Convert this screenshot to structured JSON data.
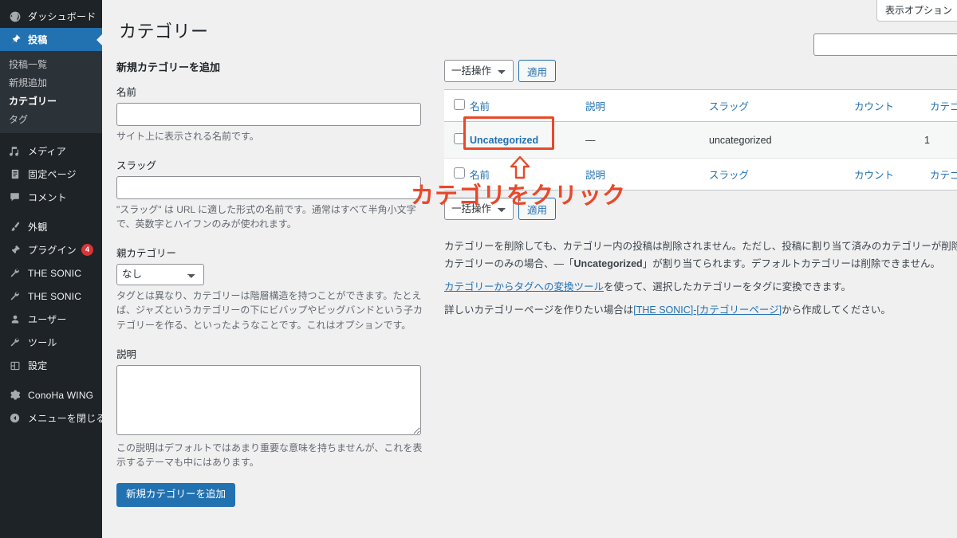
{
  "sidebar": {
    "items": [
      {
        "label": "ダッシュボード",
        "icon": "dashboard-icon",
        "current": false
      },
      {
        "label": "投稿",
        "icon": "pin-icon",
        "current": true
      },
      {
        "label": "メディア",
        "icon": "media-icon",
        "current": false
      },
      {
        "label": "固定ページ",
        "icon": "page-icon",
        "current": false
      },
      {
        "label": "コメント",
        "icon": "comment-icon",
        "current": false
      },
      {
        "label": "外観",
        "icon": "appearance-brush-icon",
        "current": false
      },
      {
        "label": "プラグイン",
        "icon": "plugin-icon",
        "current": false,
        "badge": "4"
      },
      {
        "label": "THE SONIC",
        "icon": "wrench-icon",
        "current": false
      },
      {
        "label": "THE SONIC",
        "icon": "wrench-icon",
        "current": false
      },
      {
        "label": "ユーザー",
        "icon": "user-icon",
        "current": false
      },
      {
        "label": "ツール",
        "icon": "wrench-icon",
        "current": false
      },
      {
        "label": "設定",
        "icon": "settings-icon",
        "current": false
      },
      {
        "label": "ConoHa WING",
        "icon": "gear-icon",
        "current": false
      },
      {
        "label": "メニューを閉じる",
        "icon": "collapse-icon",
        "current": false
      }
    ],
    "submenu": [
      {
        "label": "投稿一覧",
        "current": false
      },
      {
        "label": "新規追加",
        "current": false
      },
      {
        "label": "カテゴリー",
        "current": true
      },
      {
        "label": "タグ",
        "current": false
      }
    ]
  },
  "header": {
    "title": "カテゴリー",
    "screen_options": "表示オプション",
    "search_placeholder": "",
    "search_value": ""
  },
  "form": {
    "heading": "新規カテゴリーを追加",
    "name_label": "名前",
    "name_value": "",
    "name_desc": "サイト上に表示される名前です。",
    "slug_label": "スラッグ",
    "slug_value": "",
    "slug_desc": "\"スラッグ\" は URL に適した形式の名前です。通常はすべて半角小文字で、英数字とハイフンのみが使われます。",
    "parent_label": "親カテゴリー",
    "parent_selected": "なし",
    "parent_options": [
      "なし"
    ],
    "parent_desc": "タグとは異なり、カテゴリーは階層構造を持つことができます。たとえば、ジャズというカテゴリーの下にビバップやビッグバンドという子カテゴリーを作る、といったようなことです。これはオプションです。",
    "description_label": "説明",
    "description_value": "",
    "description_desc": "この説明はデフォルトではあまり重要な意味を持ちませんが、これを表示するテーマも中にはあります。",
    "submit_label": "新規カテゴリーを追加"
  },
  "tablenav": {
    "bulk_selected": "一括操作",
    "bulk_options": [
      "一括操作"
    ],
    "apply_label": "適用"
  },
  "table": {
    "columns": [
      "名前",
      "説明",
      "スラッグ",
      "カウント",
      "カテゴリペー"
    ],
    "rows": [
      {
        "name": "Uncategorized",
        "description": "—",
        "slug": "uncategorized",
        "count": "1",
        "category_page": ""
      }
    ]
  },
  "notes": {
    "line1_a": "カテゴリーを削除しても、カテゴリー内の投稿は削除されません。ただし、投稿に割り当て済みのカテゴリーが削除するカテゴリーのみの場合、",
    "line1_b": "—「",
    "line1_strong": "Uncategorized",
    "line1_c": "」が割り当てられます。デフォルトカテゴリーは削除できません。",
    "line2_link": "カテゴリーからタグへの変換ツール",
    "line2_rest": "を使って、選択したカテゴリーをタグに変換できます。",
    "line3_pre": "詳しいカテゴリーページを作りたい場合は",
    "line3_link": "[THE SONIC]-[カテゴリーページ]",
    "line3_rest": "から作成してください。"
  },
  "annotation": {
    "text": "カテゴリをクリック",
    "color": "#e8492a",
    "arrow": "up-arrow-icon"
  },
  "colors": {
    "sidebar_bg": "#1d2327",
    "submenu_bg": "#2c3338",
    "accent_blue": "#2271b1",
    "page_bg": "#f0f0f1",
    "badge_red": "#d63638",
    "annotation_red": "#e8492a"
  }
}
